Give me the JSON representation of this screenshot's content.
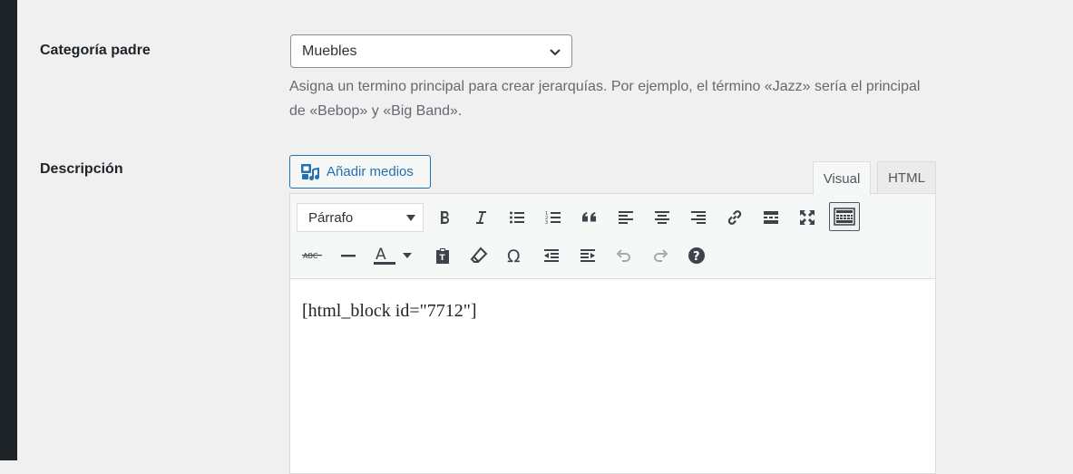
{
  "parent_category": {
    "label": "Categoría padre",
    "selected": "Muebles",
    "help": "Asigna un termino principal para crear jerarquías. Por ejemplo, el término «Jazz» sería el principal de «Bebop» y «Big Band»."
  },
  "description": {
    "label": "Descripción",
    "add_media_label": "Añadir medios",
    "tabs": {
      "visual": "Visual",
      "html": "HTML"
    },
    "format_selected": "Párrafo",
    "content": "[html_block id=\"7712\"]"
  },
  "colors": {
    "accent": "#2271b1",
    "admin_bar": "#1d2327",
    "background": "#f0f0f1"
  }
}
